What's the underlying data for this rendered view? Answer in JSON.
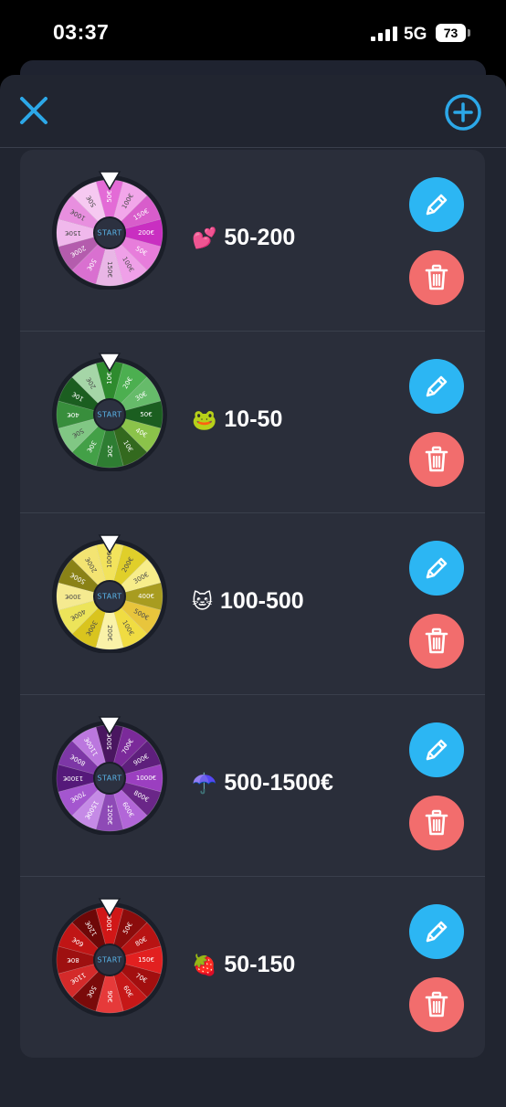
{
  "status_bar": {
    "time": "03:37",
    "network": "5G",
    "battery": "73"
  },
  "header": {
    "close_icon": "close-icon",
    "add_icon": "plus-circle-icon"
  },
  "wheels": [
    {
      "emoji": "💕",
      "title": "50-200",
      "center_label": "START",
      "segments": [
        {
          "label": "50€",
          "color": "#e36bd6"
        },
        {
          "label": "100€",
          "color": "#f2a6ea"
        },
        {
          "label": "150€",
          "color": "#d85dcb"
        },
        {
          "label": "200€",
          "color": "#c92fc1"
        },
        {
          "label": "50€",
          "color": "#e77ddb"
        },
        {
          "label": "100€",
          "color": "#efa0e8"
        },
        {
          "label": "150€",
          "color": "#e9b6e6"
        },
        {
          "label": "50€",
          "color": "#d970d0"
        },
        {
          "label": "200€",
          "color": "#b45cad"
        },
        {
          "label": "150€",
          "color": "#f0b8ec"
        },
        {
          "label": "100€",
          "color": "#e88fdf"
        },
        {
          "label": "50€",
          "color": "#f6c9f1"
        }
      ]
    },
    {
      "emoji": "🐸",
      "title": "10-50",
      "center_label": "START",
      "segments": [
        {
          "label": "10€",
          "color": "#2e8b2e"
        },
        {
          "label": "20€",
          "color": "#4caf50"
        },
        {
          "label": "30€",
          "color": "#66bb6a"
        },
        {
          "label": "50€",
          "color": "#1b5e20"
        },
        {
          "label": "40€",
          "color": "#8bc34a"
        },
        {
          "label": "10€",
          "color": "#33691e"
        },
        {
          "label": "20€",
          "color": "#2e7d32"
        },
        {
          "label": "30€",
          "color": "#43a047"
        },
        {
          "label": "50€",
          "color": "#81c784"
        },
        {
          "label": "40€",
          "color": "#388e3c"
        },
        {
          "label": "10€",
          "color": "#1b5e20"
        },
        {
          "label": "20€",
          "color": "#a5d6a7"
        }
      ]
    },
    {
      "emoji": "🐱",
      "title": "100-500",
      "center_label": "START",
      "segments": [
        {
          "label": "100€",
          "color": "#f2e35c"
        },
        {
          "label": "200€",
          "color": "#e0cf2a"
        },
        {
          "label": "300€",
          "color": "#f7ed8a"
        },
        {
          "label": "400€",
          "color": "#a89c20"
        },
        {
          "label": "500€",
          "color": "#e8c53c"
        },
        {
          "label": "100€",
          "color": "#f0dc42"
        },
        {
          "label": "200€",
          "color": "#faf2a8"
        },
        {
          "label": "300€",
          "color": "#d9c41e"
        },
        {
          "label": "400€",
          "color": "#ece45a"
        },
        {
          "label": "300€",
          "color": "#f5ea90"
        },
        {
          "label": "500€",
          "color": "#8a8216"
        },
        {
          "label": "200€",
          "color": "#f3e472"
        }
      ]
    },
    {
      "emoji": "☂️",
      "title": "500-1500€",
      "center_label": "START",
      "segments": [
        {
          "label": "500€",
          "color": "#4a1660"
        },
        {
          "label": "700€",
          "color": "#7b2a9a"
        },
        {
          "label": "900€",
          "color": "#5e1f7c"
        },
        {
          "label": "1000€",
          "color": "#9b3fc0"
        },
        {
          "label": "800€",
          "color": "#6a2688"
        },
        {
          "label": "600€",
          "color": "#b266d8"
        },
        {
          "label": "1200€",
          "color": "#8e4ab6"
        },
        {
          "label": "1500€",
          "color": "#c58ae6"
        },
        {
          "label": "700€",
          "color": "#a456cf"
        },
        {
          "label": "1300€",
          "color": "#55197a"
        },
        {
          "label": "800€",
          "color": "#7d37a6"
        },
        {
          "label": "1100€",
          "color": "#bb77de"
        }
      ]
    },
    {
      "emoji": "🍓",
      "title": "50-150",
      "center_label": "START",
      "segments": [
        {
          "label": "100€",
          "color": "#d11717"
        },
        {
          "label": "50€",
          "color": "#8b0c0c"
        },
        {
          "label": "80€",
          "color": "#b81313"
        },
        {
          "label": "150€",
          "color": "#e22020"
        },
        {
          "label": "70€",
          "color": "#a20f0f"
        },
        {
          "label": "60€",
          "color": "#c61818"
        },
        {
          "label": "90€",
          "color": "#e63a3a"
        },
        {
          "label": "50€",
          "color": "#7a0a0a"
        },
        {
          "label": "110€",
          "color": "#d42a2a"
        },
        {
          "label": "80€",
          "color": "#9e1010"
        },
        {
          "label": "60€",
          "color": "#c01515"
        },
        {
          "label": "120€",
          "color": "#6e0808"
        }
      ]
    }
  ],
  "actions": {
    "edit_icon": "pencil-icon",
    "delete_icon": "trash-icon"
  }
}
